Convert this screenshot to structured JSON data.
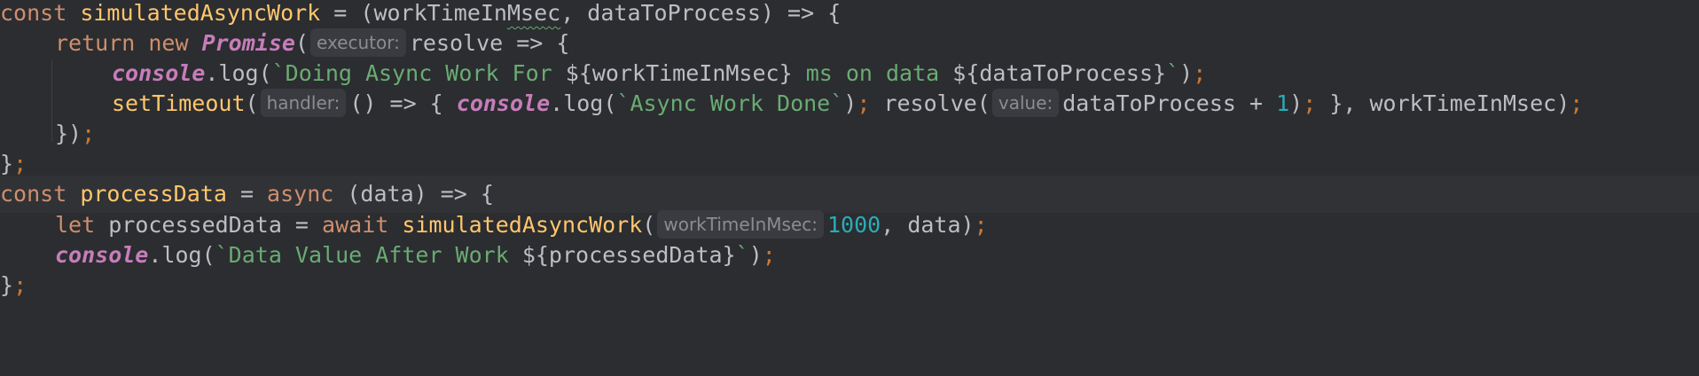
{
  "editor": {
    "language": "javascript",
    "lines": [
      {
        "parts": {
          "kw_const": "const ",
          "fn_name": "simulatedAsyncWork",
          "p1": " = (workTimeIn",
          "p1_squiggle": "Msec",
          "p1_rest": ", dataToProcess) => {"
        }
      },
      {
        "parts": {
          "kw_return": "return ",
          "kw_new": "new ",
          "cls_promise": "Promise",
          "paren": "(",
          "hint": "executor:",
          "rest": "resolve => {"
        }
      },
      {
        "parts": {
          "glob": "console",
          "dot_log": ".log(",
          "str1": "`Doing Async Work For ",
          "tmpl1": "${workTimeInMsec}",
          "str2": " ms on data ",
          "tmpl2": "${dataToProcess}",
          "str3": "`",
          "close": ")",
          "semi": ";"
        }
      },
      {
        "parts": {
          "fn": "setTimeout",
          "paren": "(",
          "hint_handler": "handler:",
          "arrow": "() => { ",
          "glob": "console",
          "dot_log": ".log(",
          "str": "`Async Work Done`",
          "close": ")",
          "semi1": "; ",
          "resolve": "resolve(",
          "hint_value": "value:",
          "expr": "dataToProcess + ",
          "num": "1",
          "close2": ")",
          "semi2": ";",
          "tail": " }, workTimeInMsec)",
          "semi3": ";"
        }
      },
      {
        "parts": {
          "close": "})",
          "semi": ";"
        }
      },
      {
        "parts": {
          "close": "}",
          "semi": ";"
        }
      },
      {
        "parts": {
          "kw_const": "const ",
          "fn_name": "processData",
          "p1": " = ",
          "kw_async": "async",
          "p2": " (data) => {"
        }
      },
      {
        "parts": {
          "kw_let": "let ",
          "var": "processedData = ",
          "kw_await": "await ",
          "fn": "simulatedAsyncWork",
          "paren": "(",
          "hint": "workTimeInMsec:",
          "num": "1000",
          "rest": ", data)",
          "semi": ";"
        }
      },
      {
        "parts": {
          "glob": "console",
          "dot_log": ".log(",
          "str1": "`Data Value After Work ",
          "tmpl": "${processedData}",
          "str2": "`",
          "close": ")",
          "semi": ";"
        }
      },
      {
        "parts": {
          "close": "}",
          "semi": ";"
        }
      }
    ]
  }
}
